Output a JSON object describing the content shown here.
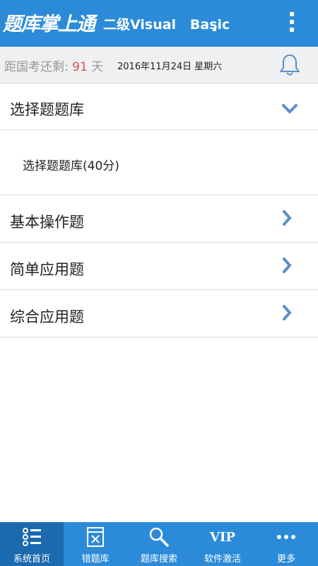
{
  "header": {
    "logo_text": "题库掌上通",
    "title": "二级Visual   Basic"
  },
  "status": {
    "countdown_prefix": "距国考还剩:",
    "countdown_days": "91",
    "countdown_suffix": "天",
    "date": "2016年11月24日  星期六"
  },
  "sections": [
    {
      "label": "选择题题库",
      "expanded": true
    },
    {
      "label": "选择题题库(40分)"
    },
    {
      "label": "基本操作题",
      "expanded": false
    },
    {
      "label": "简单应用题",
      "expanded": false
    },
    {
      "label": "综合应用题",
      "expanded": false
    }
  ],
  "tabs": [
    {
      "label": "系统首页",
      "icon": "home-list-icon",
      "active": true
    },
    {
      "label": "错题库",
      "icon": "wrong-question-icon"
    },
    {
      "label": "题库搜索",
      "icon": "search-icon"
    },
    {
      "label": "软件激活",
      "icon_text": "VIP"
    },
    {
      "label": "更多",
      "icon": "more-dots-icon"
    }
  ],
  "colors": {
    "primary": "#2b8bd8",
    "active_tab": "#1b6ab0",
    "days_red": "#d9534f",
    "chevron": "#5b8fc6"
  }
}
